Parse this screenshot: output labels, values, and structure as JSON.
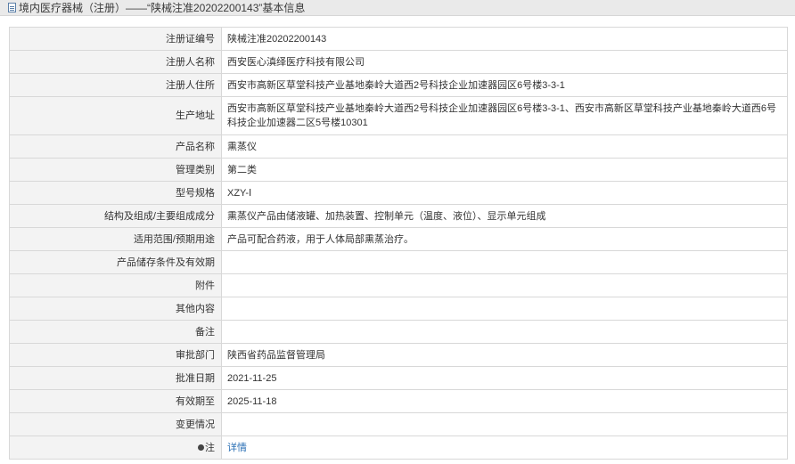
{
  "header": {
    "title": "境内医疗器械（注册）——“陕械注准20202200143”基本信息",
    "icon": "document-icon"
  },
  "rows": [
    {
      "label": "注册证编号",
      "value": "陕械注准20202200143"
    },
    {
      "label": "注册人名称",
      "value": "西安医心滇绎医疗科技有限公司"
    },
    {
      "label": "注册人住所",
      "value": "西安市高新区草堂科技产业基地秦岭大道西2号科技企业加速器园区6号楼3-3-1"
    },
    {
      "label": "生产地址",
      "value": "西安市高新区草堂科技产业基地秦岭大道西2号科技企业加速器园区6号楼3-3-1、西安市高新区草堂科技产业基地秦岭大道西6号科技企业加速器二区5号楼10301"
    },
    {
      "label": "产品名称",
      "value": "熏蒸仪"
    },
    {
      "label": "管理类别",
      "value": "第二类"
    },
    {
      "label": "型号规格",
      "value": "XZY-Ⅰ"
    },
    {
      "label": "结构及组成/主要组成成分",
      "value": "熏蒸仪产品由储液罐、加热装置、控制单元（温度、液位）、显示单元组成"
    },
    {
      "label": "适用范围/预期用途",
      "value": "产品可配合药液，用于人体局部熏蒸治疗。"
    },
    {
      "label": "产品储存条件及有效期",
      "value": ""
    },
    {
      "label": "附件",
      "value": ""
    },
    {
      "label": "其他内容",
      "value": ""
    },
    {
      "label": "备注",
      "value": ""
    },
    {
      "label": "审批部门",
      "value": "陕西省药品监督管理局"
    },
    {
      "label": "批准日期",
      "value": "2021-11-25"
    },
    {
      "label": "有效期至",
      "value": "2025-11-18"
    },
    {
      "label": "变更情况",
      "value": ""
    }
  ],
  "note": {
    "label": "注",
    "link_text": "详情",
    "icon": "bullet-icon"
  },
  "colors": {
    "link": "#2a6fb5",
    "label_bg": "#f3f3f3",
    "border": "#d8d8d8",
    "titlebar_bg": "#eaeaea"
  }
}
